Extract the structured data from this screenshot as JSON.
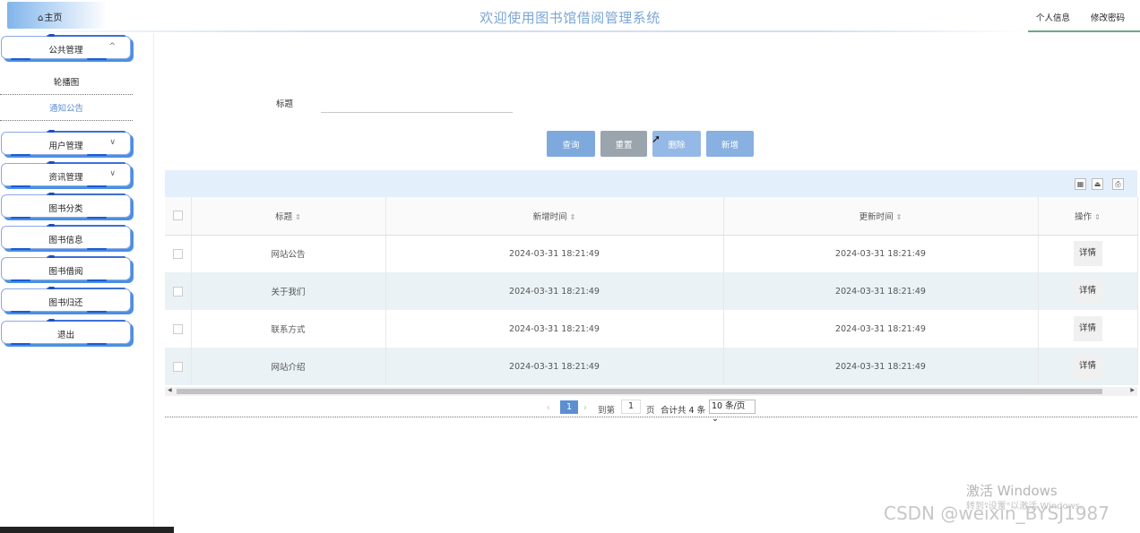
{
  "header": {
    "home_label": "主页",
    "app_title": "欢迎使用图书馆借阅管理系统",
    "profile_label": "个人信息",
    "change_password_label": "修改密码"
  },
  "sidebar": {
    "public_menu": {
      "label": "公共管理",
      "sub_items": [
        "轮播图",
        "通知公告"
      ]
    },
    "items": [
      {
        "label": "用户管理",
        "has_caret": true
      },
      {
        "label": "资讯管理",
        "has_caret": true
      },
      {
        "label": "图书分类"
      },
      {
        "label": "图书信息"
      },
      {
        "label": "图书借阅"
      },
      {
        "label": "图书归还"
      },
      {
        "label": "退出"
      }
    ]
  },
  "search": {
    "title_label": "标题",
    "title_value": ""
  },
  "actions": {
    "search_label": "查询",
    "reset_label": "重置",
    "delete_label": "删除",
    "add_label": "新增"
  },
  "table": {
    "columns": [
      "标题",
      "新增时间",
      "更新时间",
      "操作"
    ],
    "rows": [
      {
        "title": "网站公告",
        "created": "2024-03-31 18:21:49",
        "updated": "2024-03-31 18:21:49",
        "action": "详情"
      },
      {
        "title": "关于我们",
        "created": "2024-03-31 18:21:49",
        "updated": "2024-03-31 18:21:49",
        "action": "详情"
      },
      {
        "title": "联系方式",
        "created": "2024-03-31 18:21:49",
        "updated": "2024-03-31 18:21:49",
        "action": "详情"
      },
      {
        "title": "网站介绍",
        "created": "2024-03-31 18:21:49",
        "updated": "2024-03-31 18:21:49",
        "action": "详情"
      }
    ]
  },
  "pagination": {
    "current_page": "1",
    "goto_label": "到第",
    "goto_value": "1",
    "page_label": "页",
    "total_text": "合计共 4 条",
    "page_size": "10 条/页"
  },
  "overlay": {
    "windows_activate": "激活 Windows",
    "windows_activate_hint": "转到\"设置\"以激活 Windows。",
    "csdn_watermark": "CSDN @weixin_BYSJ1987"
  },
  "colors": {
    "accent": "#5b8fd1",
    "title": "#7ba6d6",
    "menu_border": "#8da8e6",
    "menu_shadow": "#4a90e2",
    "row_alt": "#eaf2f5",
    "toolbar_bg": "#e4effc"
  }
}
